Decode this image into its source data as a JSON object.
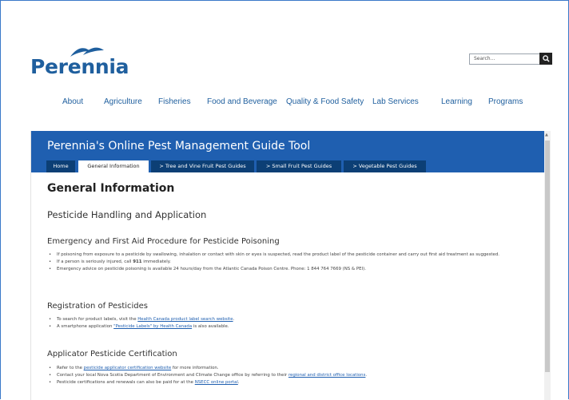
{
  "header": {
    "logo_text": "Perennia",
    "search": {
      "placeholder": "Search..."
    }
  },
  "nav": {
    "items": [
      {
        "label": "About"
      },
      {
        "label": "Agriculture"
      },
      {
        "label": "Fisheries"
      },
      {
        "label": "Food and Beverage"
      },
      {
        "label": "Quality & Food Safety"
      },
      {
        "label": "Lab Services"
      },
      {
        "label": "Learning"
      },
      {
        "label": "Programs"
      }
    ]
  },
  "tool": {
    "title": "Perennia's Online Pest Management Guide Tool",
    "tabs": [
      {
        "label": "Home"
      },
      {
        "label": "General Information"
      },
      {
        "label": "> Tree and Vine Fruit Pest Guides"
      },
      {
        "label": "> Small Fruit Pest Guides"
      },
      {
        "label": "> Vegetable Pest Guides"
      }
    ]
  },
  "page": {
    "title": "General Information",
    "section_title": "Pesticide Handling and Application",
    "emergency": {
      "heading": "Emergency and First Aid Procedure for Pesticide Poisoning",
      "item1": "If poisoning from exposure to a pesticide by swallowing, inhalation or contact with skin or eyes is suspected, read the product label of the pesticide container and carry out first aid treatment as suggested.",
      "item2_pre": "If a person is seriously injured, call ",
      "item2_bold": "911",
      "item2_post": " immediately.",
      "item3": "Emergency advice on pesticide poisoning is available 24 hours/day from the Atlantic Canada Poison Centre. Phone: 1 844 764 7669 (NS & PEI)."
    },
    "registration": {
      "heading": "Registration of Pesticides",
      "item1_pre": "To search for product labels, visit the ",
      "item1_link": "Health Canada product label search website",
      "item1_post": ".",
      "item2_pre": "A smartphone application ",
      "item2_link": "\"Pesticide Labels\" by Health Canada",
      "item2_post": " is also available."
    },
    "certification": {
      "heading": "Applicator Pesticide Certification",
      "item1_pre": "Refer to the ",
      "item1_link": "pesticide applicator certification website",
      "item1_post": " for more information.",
      "item2_pre": "Contact your local Nova Scotia Department of Environment and Climate Change office by referring to their ",
      "item2_link": "regional and district office locations",
      "item2_post": ".",
      "item3_pre": "Pesticide certifications and renewals can also be paid for at the ",
      "item3_link": "NSECC online portal",
      "item3_post": "."
    }
  },
  "colors": {
    "brand_blue": "#1f5fb0",
    "tab_dark": "#0c3f75",
    "logo_blue": "#1f5f9e"
  }
}
